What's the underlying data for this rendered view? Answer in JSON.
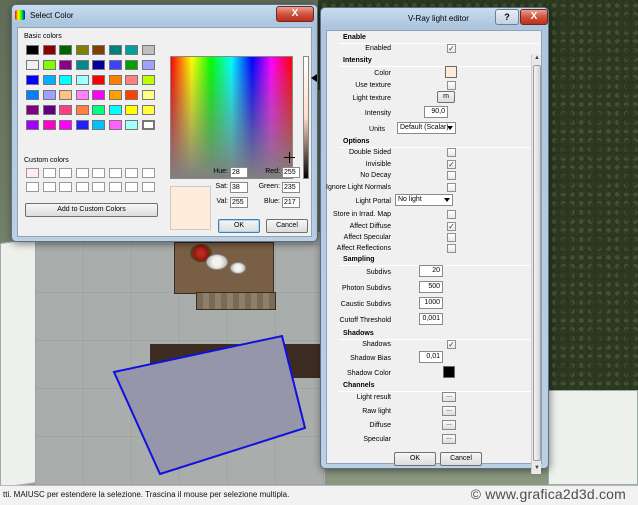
{
  "select_color": {
    "title": "Select Color",
    "close_label": "X",
    "basic_colors_label": "Basic colors",
    "basic_colors": [
      "#000000",
      "#8b0000",
      "#006400",
      "#808000",
      "#804000",
      "#008080",
      "#00a0a0",
      "#c0c0c0",
      "#f0f0f0",
      "#80ff00",
      "#8b008b",
      "#008b8b",
      "#0000a0",
      "#4040ff",
      "#00a000",
      "#a0a0ff",
      "#0000ff",
      "#00b0ff",
      "#00ffff",
      "#a0ffff",
      "#ff0000",
      "#ff8000",
      "#ff8080",
      "#c0ff00",
      "#0080ff",
      "#a0a0ff",
      "#ffc080",
      "#ff80ff",
      "#ff00ff",
      "#ffa000",
      "#ff4000",
      "#ffff80",
      "#800080",
      "#600080",
      "#ff4080",
      "#ff8040",
      "#00ff80",
      "#00ffff",
      "#ffff00",
      "#ffff40",
      "#a000ff",
      "#ff00c0",
      "#ff00ff",
      "#2020ff",
      "#00c0ff",
      "#ff60ff",
      "#a0ffff",
      "#ffffff"
    ],
    "custom_colors_label": "Custom colors",
    "custom_colors": [
      "#ffebf5",
      "#ffffff",
      "#ffffff",
      "#ffffff",
      "#ffffff",
      "#ffffff",
      "#ffffff",
      "#ffffff",
      "#ffffff",
      "#ffffff",
      "#ffffff",
      "#ffffff",
      "#ffffff",
      "#ffffff",
      "#ffffff",
      "#ffffff"
    ],
    "add_custom_label": "Add to Custom Colors",
    "fields": {
      "hue_label": "Hue:",
      "hue": "28",
      "sat_label": "Sat:",
      "sat": "38",
      "val_label": "Val:",
      "val": "255",
      "red_label": "Red:",
      "red": "255",
      "green_label": "Green:",
      "green": "235",
      "blue_label": "Blue:",
      "blue": "217"
    },
    "preview_color": "#ffebd9",
    "ok_label": "OK",
    "cancel_label": "Cancel"
  },
  "vray": {
    "title": "V-Ray light editor",
    "help_label": "?",
    "close_label": "X",
    "enable": {
      "head": "Enable",
      "enabled_label": "Enabled",
      "enabled": true
    },
    "intensity": {
      "head": "Intensity",
      "color_label": "Color",
      "color": "#ffebd9",
      "use_texture_label": "Use texture",
      "use_texture": false,
      "light_texture_label": "Light texture",
      "light_texture_btn": "m",
      "intensity_label": "Intensity",
      "intensity_value": "90,0",
      "units_label": "Units",
      "units_value": "Default (Scalar)"
    },
    "options": {
      "head": "Options",
      "double_sided_label": "Double Sided",
      "double_sided": false,
      "invisible_label": "Invisible",
      "invisible": true,
      "no_decay_label": "No Decay",
      "no_decay": false,
      "ignore_normals_label": "Ignore Light Normals",
      "ignore_normals": false,
      "light_portal_label": "Light Portal",
      "light_portal_value": "No light",
      "store_irrad_label": "Store in Irrad. Map",
      "store_irrad": false,
      "affect_diffuse_label": "Affect Diffuse",
      "affect_diffuse": true,
      "affect_specular_label": "Affect Specular",
      "affect_specular": false,
      "affect_reflections_label": "Affect Reflections",
      "affect_reflections": false
    },
    "sampling": {
      "head": "Sampling",
      "subdivs_label": "Subdivs",
      "subdivs": "20",
      "photon_subdivs_label": "Photon Subdivs",
      "photon_subdivs": "500",
      "caustic_subdivs_label": "Caustic Subdivs",
      "caustic_subdivs": "1000",
      "cutoff_label": "Cutoff Threshold",
      "cutoff": "0,001"
    },
    "shadows": {
      "head": "Shadows",
      "shadows_label": "Shadows",
      "shadows": true,
      "shadow_bias_label": "Shadow Bias",
      "shadow_bias": "0,01",
      "shadow_color_label": "Shadow Color",
      "shadow_color": "#000000"
    },
    "channels": {
      "head": "Channels",
      "light_result_label": "Light result",
      "raw_light_label": "Raw light",
      "diffuse_label": "Diffuse",
      "specular_label": "Specular",
      "dots_label": "..."
    },
    "ok_label": "OK",
    "cancel_label": "Cancel"
  },
  "statusbar": {
    "text": "tti. MAIUSC per estendere la selezione. Trascina il mouse per selezione multipla.",
    "watermark": "© www.grafica2d3d.com"
  },
  "check_mark": "✓"
}
